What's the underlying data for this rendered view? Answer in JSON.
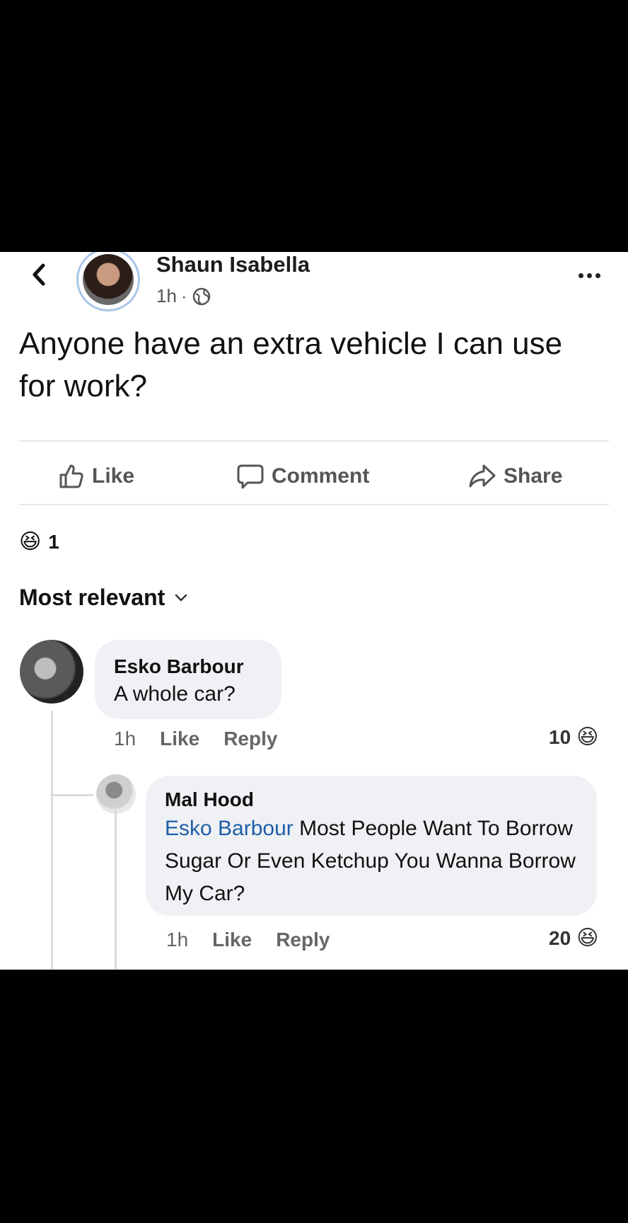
{
  "post": {
    "author": "Shaun Isabella",
    "time": "1h",
    "dot": "·",
    "audience_icon": "globe-icon",
    "text": "Anyone have an extra vehicle I can use for work?"
  },
  "actions": {
    "like_label": "Like",
    "comment_label": "Comment",
    "share_label": "Share"
  },
  "reactions": {
    "emoji": "😆",
    "count": "1"
  },
  "sort": {
    "label": "Most relevant"
  },
  "comments": [
    {
      "author": "Esko Barbour",
      "text": "A whole car?",
      "time": "1h",
      "like_label": "Like",
      "reply_label": "Reply",
      "reaction_count": "10",
      "reaction_emoji": "😆"
    }
  ],
  "replies": [
    {
      "author": "Mal Hood",
      "mention": "Esko Barbour",
      "text": " Most People Want To Borrow Sugar Or Even Ketchup You Wanna Borrow My Car?",
      "time": "1h",
      "like_label": "Like",
      "reply_label": "Reply",
      "reaction_count": "20",
      "reaction_emoji": "😆"
    }
  ],
  "colors": {
    "mention": "#1d5ea8",
    "bubble": "#eff1f4",
    "divider": "#e4e6e9"
  }
}
